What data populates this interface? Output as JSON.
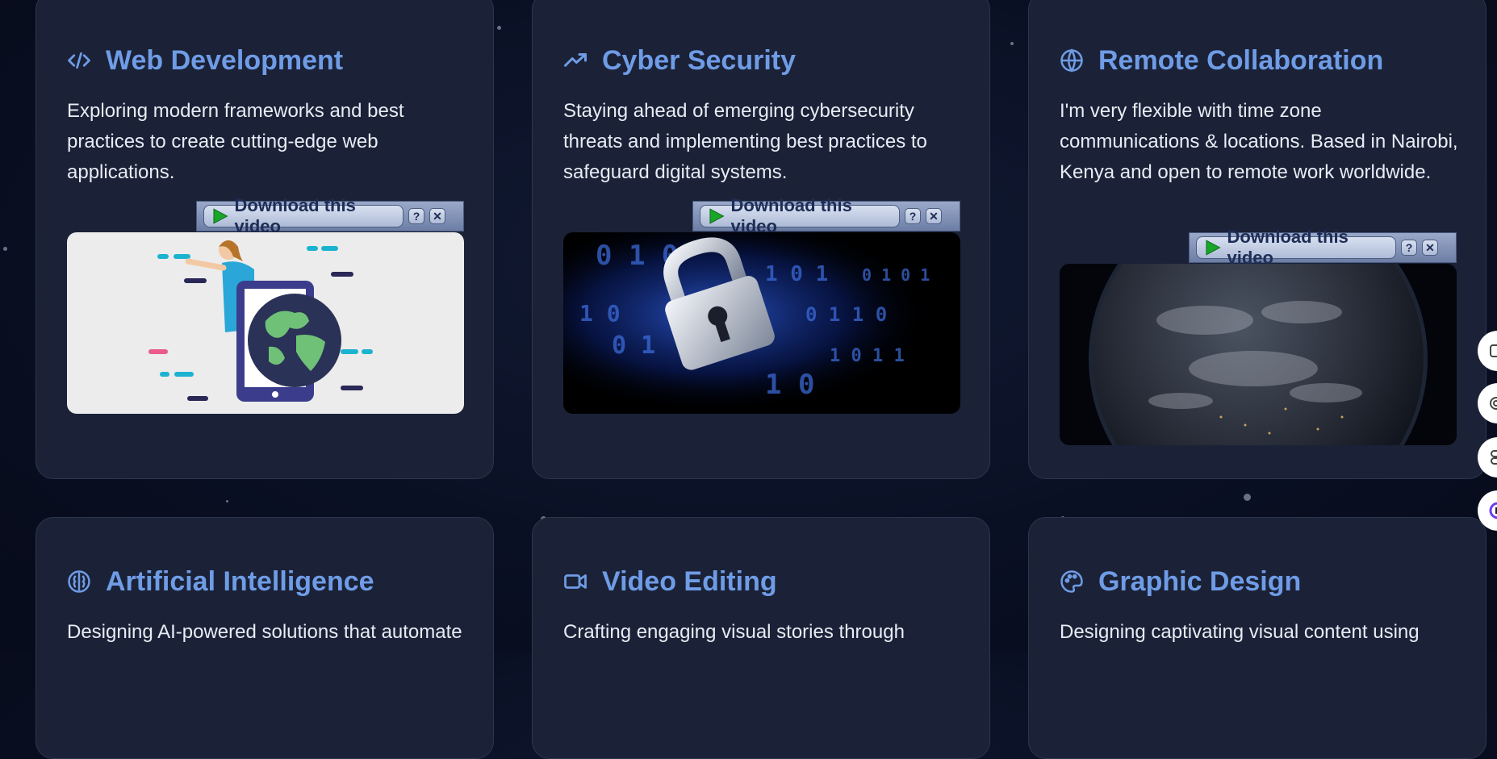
{
  "cards": [
    {
      "title": "Web Development",
      "icon": "code-icon",
      "description": "Exploring modern frameworks and best practices to create cutting-edge web applications.",
      "media": "web-development-illustration"
    },
    {
      "title": "Cyber Security",
      "icon": "trending-up-icon",
      "description": "Staying ahead of emerging cybersecurity threats and implementing best practices to safeguard digital systems.",
      "media": "cyber-security-lock-video"
    },
    {
      "title": "Remote Collaboration",
      "icon": "globe-icon",
      "description": "I'm very flexible with time zone communications & locations. Based in Nairobi, Kenya and open to remote work worldwide.",
      "media": "earth-video"
    },
    {
      "title": "Artificial Intelligence",
      "icon": "brain-icon",
      "description": "Designing AI-powered solutions that automate"
    },
    {
      "title": "Video Editing",
      "icon": "video-camera-icon",
      "description": "Crafting engaging visual stories through"
    },
    {
      "title": "Graphic Design",
      "icon": "palette-icon",
      "description": "Designing captivating visual content using"
    }
  ],
  "download_bar": {
    "label": "Download this video",
    "help": "?",
    "close": "✕"
  },
  "colors": {
    "background": "#0a1024",
    "card": "#1b2237",
    "accent": "#6f9ce6",
    "text": "#e8ecf4"
  }
}
